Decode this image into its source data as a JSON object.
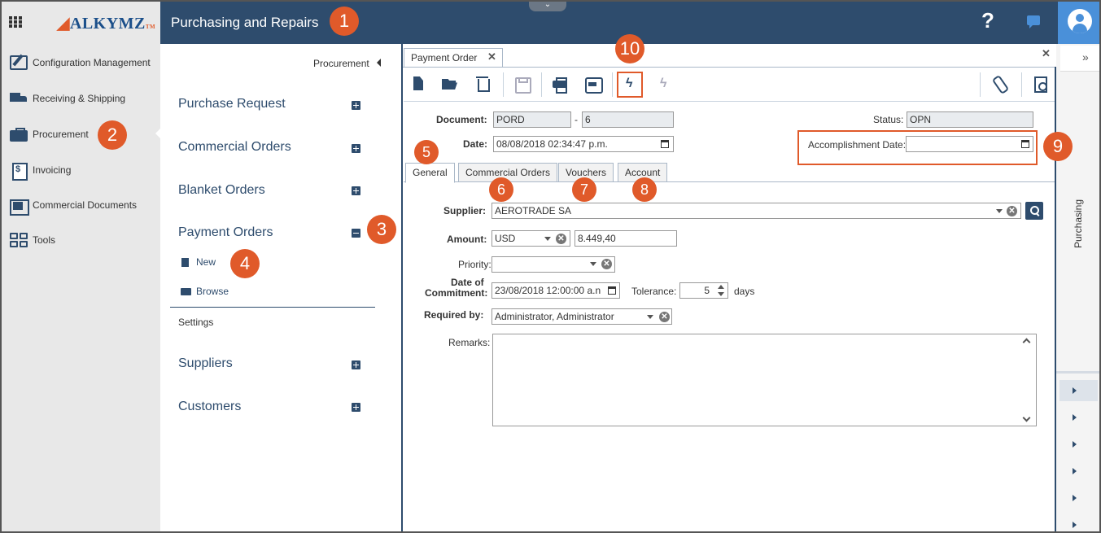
{
  "app": {
    "logo_text": "ALKYMZ",
    "logo_tm": "TM",
    "title": "Purchasing and Repairs",
    "help_glyph": "?"
  },
  "leftnav": {
    "items": [
      {
        "label": "Configuration Management",
        "icon": "config-icon"
      },
      {
        "label": "Receiving & Shipping",
        "icon": "truck-icon"
      },
      {
        "label": "Procurement",
        "icon": "briefcase-icon"
      },
      {
        "label": "Invoicing",
        "icon": "invoice-icon"
      },
      {
        "label": "Commercial Documents",
        "icon": "documents-icon"
      },
      {
        "label": "Tools",
        "icon": "tools-icon"
      }
    ]
  },
  "midpanel": {
    "header": "Procurement",
    "sections": [
      {
        "label": "Purchase Request"
      },
      {
        "label": "Commercial Orders"
      },
      {
        "label": "Blanket Orders"
      },
      {
        "label": "Payment Orders"
      },
      {
        "label": "Suppliers"
      },
      {
        "label": "Customers"
      }
    ],
    "sub_new": "New",
    "sub_browse": "Browse",
    "settings": "Settings"
  },
  "document": {
    "tab_label": "Payment Order",
    "close_glyph": "✕"
  },
  "form": {
    "document_label": "Document:",
    "document_prefix": "PORD",
    "document_dash": "-",
    "document_number": "6",
    "status_label": "Status:",
    "status_value": "OPN",
    "date_label": "Date:",
    "date_value": "08/08/2018 02:34:47 p.m.",
    "accomplishment_label": "Accomplishment Date:",
    "accomplishment_value": "",
    "tabs": [
      "General",
      "Commercial Orders",
      "Vouchers",
      "Account"
    ],
    "supplier_label": "Supplier:",
    "supplier_value": "AEROTRADE SA",
    "amount_label": "Amount:",
    "currency_value": "USD",
    "amount_value": "8.449,40",
    "priority_label": "Priority:",
    "priority_value": "",
    "commitment_label_1": "Date of",
    "commitment_label_2": "Commitment:",
    "commitment_value": "23/08/2018 12:00:00 a.n",
    "tolerance_label": "Tolerance:",
    "tolerance_value": "5",
    "days_label": "days",
    "required_label": "Required by:",
    "required_value": "Administrator, Administrator",
    "remarks_label": "Remarks:",
    "remarks_value": ""
  },
  "rightpanel": {
    "collapse_glyph": "»",
    "vertical_label": "Purchasing"
  },
  "callouts": [
    "1",
    "2",
    "3",
    "4",
    "5",
    "6",
    "7",
    "8",
    "9",
    "10"
  ],
  "colors": {
    "header_bg": "#2e4c6d",
    "accent": "#e05a2a",
    "user_bg": "#4a90d9",
    "nav_bg": "#e8e8e8"
  }
}
